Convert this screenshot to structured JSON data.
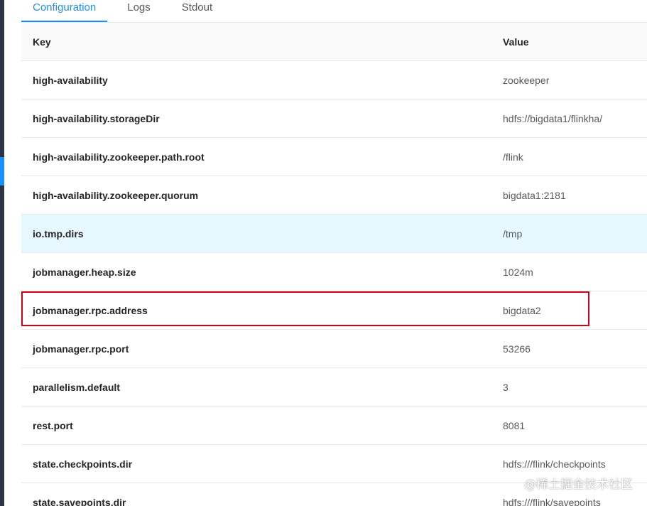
{
  "tabs": [
    {
      "label": "Configuration",
      "active": true
    },
    {
      "label": "Logs",
      "active": false
    },
    {
      "label": "Stdout",
      "active": false
    }
  ],
  "table": {
    "headers": {
      "key": "Key",
      "value": "Value"
    },
    "rows": [
      {
        "key": "high-availability",
        "value": "zookeeper"
      },
      {
        "key": "high-availability.storageDir",
        "value": "hdfs://bigdata1/flinkha/"
      },
      {
        "key": "high-availability.zookeeper.path.root",
        "value": "/flink"
      },
      {
        "key": "high-availability.zookeeper.quorum",
        "value": "bigdata1:2181"
      },
      {
        "key": "io.tmp.dirs",
        "value": "/tmp",
        "hovered": true
      },
      {
        "key": "jobmanager.heap.size",
        "value": "1024m"
      },
      {
        "key": "jobmanager.rpc.address",
        "value": "bigdata2",
        "highlighted": true
      },
      {
        "key": "jobmanager.rpc.port",
        "value": "53266"
      },
      {
        "key": "parallelism.default",
        "value": "3"
      },
      {
        "key": "rest.port",
        "value": "8081"
      },
      {
        "key": "state.checkpoints.dir",
        "value": "hdfs:///flink/checkpoints"
      },
      {
        "key": "state.savepoints.dir",
        "value": "hdfs:///flink/savepoints"
      }
    ]
  },
  "watermark": "@稀土掘金技术社区",
  "colors": {
    "accent": "#1890ff",
    "highlight_border": "#d0021b",
    "hover_row": "#e6f7ff"
  }
}
